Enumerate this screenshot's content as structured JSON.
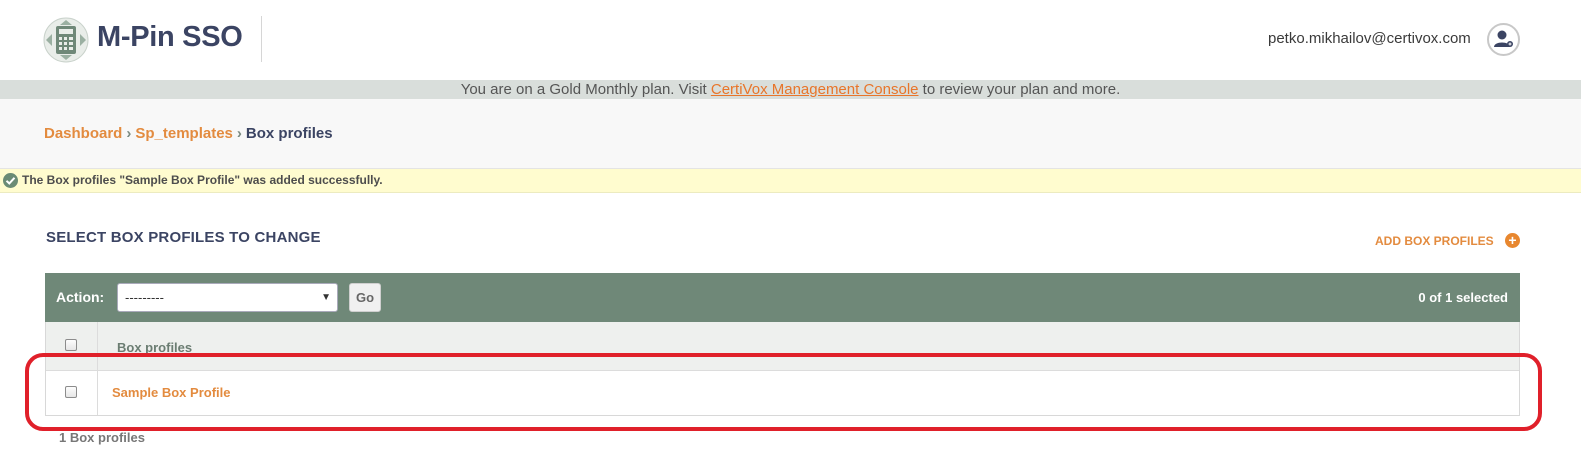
{
  "header": {
    "brand": "M-Pin SSO",
    "user_email": "petko.mikhailov@certivox.com",
    "logo_icon": "calculator-logo-icon",
    "avatar_icon": "user-avatar-icon"
  },
  "plan_banner": {
    "prefix": "You are on a Gold Monthly plan. Visit ",
    "link": "CertiVox Management Console",
    "suffix": " to review your plan and more."
  },
  "breadcrumb": {
    "items": [
      "Dashboard",
      "Sp_templates"
    ],
    "separator": "›",
    "current": "Box profiles"
  },
  "message": {
    "text": "The Box profiles \"Sample Box Profile\" was added successfully.",
    "icon": "checkmark-icon"
  },
  "content": {
    "heading": "SELECT BOX PROFILES TO CHANGE",
    "add_label": "ADD BOX PROFILES",
    "add_icon": "plus-circle-icon"
  },
  "actions": {
    "label": "Action:",
    "select_value": "---------",
    "go_label": "Go",
    "selected_count": "0 of 1 selected"
  },
  "table": {
    "column_header": "Box profiles",
    "rows": [
      {
        "name": "Sample Box Profile"
      }
    ]
  },
  "result_count": "1 Box profiles",
  "colors": {
    "accent": "#e38b3f",
    "action_bar": "#6f8878",
    "highlight": "#e0202a",
    "message_bg": "#fffccf"
  }
}
